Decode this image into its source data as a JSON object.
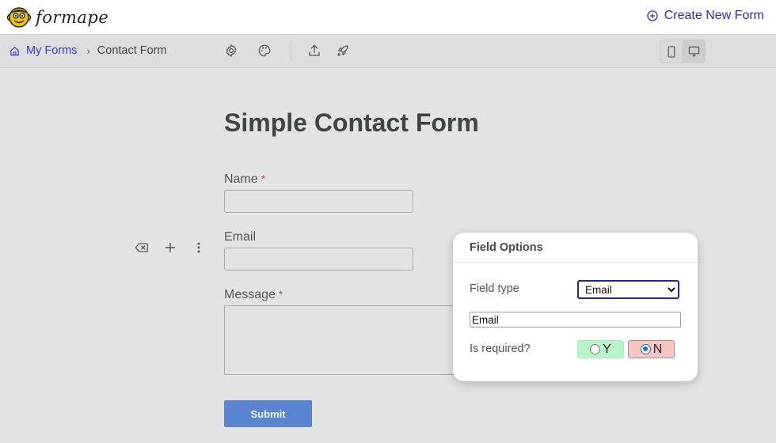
{
  "app": {
    "brand": "formape",
    "create_button": "Create New Form"
  },
  "breadcrumb": {
    "home_label": "My Forms",
    "separator": "›",
    "current": "Contact Form"
  },
  "toolbar": {
    "icons": [
      "settings-icon",
      "palette-icon",
      "upload-icon",
      "rocket-icon"
    ],
    "device_modes": [
      "mobile",
      "desktop"
    ],
    "active_device": "desktop"
  },
  "form": {
    "title": "Simple Contact Form",
    "fields": [
      {
        "label": "Name",
        "required": true,
        "required_mark": "*",
        "type": "text",
        "value": ""
      },
      {
        "label": "Email",
        "required": false,
        "type": "email",
        "value": ""
      },
      {
        "label": "Message",
        "required": true,
        "required_mark": "*",
        "type": "textarea",
        "value": ""
      }
    ],
    "submit_label": "Submit"
  },
  "field_options": {
    "title": "Field Options",
    "field_type_label": "Field type",
    "field_type_value": "Email",
    "field_name_value": "Email",
    "required_label": "Is required?",
    "yes_label": "Y",
    "no_label": "N",
    "required_selected": "N",
    "colors": {
      "yes_bg": "#b8f5c9",
      "no_bg": "#f6c6c3"
    }
  },
  "colors": {
    "accent": "#2a2ad0",
    "submit": "#5a83d0",
    "background": "#e3e3e3"
  }
}
